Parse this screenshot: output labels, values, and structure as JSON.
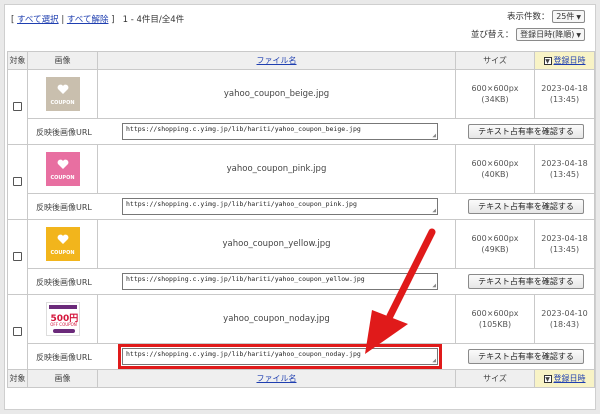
{
  "header": {
    "select_all": "すべて選択",
    "separator": "|",
    "deselect_all": "すべて解除",
    "bracket_open": "[",
    "bracket_close": "]",
    "range_text": "1 - 4件目/全4件",
    "per_page_label": "表示件数：",
    "per_page_value": "25件",
    "sort_label": "並び替え：",
    "sort_value": "登録日時(降順)"
  },
  "columns": {
    "target": "対象",
    "image": "画像",
    "filename": "ファイル名",
    "size": "サイズ",
    "date": "登録日時"
  },
  "url_label": "反映後画像URL",
  "check_button": "テキスト占有率を確認する",
  "rows": [
    {
      "filename": "yahoo_coupon_beige.jpg",
      "dimensions": "600×600px",
      "filesize": "(34KB)",
      "date": "2023-04-18",
      "time": "(13:45)",
      "url": "https://shopping.c.yimg.jp/lib/hariti/yahoo_coupon_beige.jpg",
      "thumb_color": "#c9bfae",
      "thumb_text": "COUPON"
    },
    {
      "filename": "yahoo_coupon_pink.jpg",
      "dimensions": "600×600px",
      "filesize": "(40KB)",
      "date": "2023-04-18",
      "time": "(13:45)",
      "url": "https://shopping.c.yimg.jp/lib/hariti/yahoo_coupon_pink.jpg",
      "thumb_color": "#e86fa1",
      "thumb_text": "COUPON"
    },
    {
      "filename": "yahoo_coupon_yellow.jpg",
      "dimensions": "600×600px",
      "filesize": "(49KB)",
      "date": "2023-04-18",
      "time": "(13:45)",
      "url": "https://shopping.c.yimg.jp/lib/hariti/yahoo_coupon_yellow.jpg",
      "thumb_color": "#f2b51c",
      "thumb_text": "COUPON"
    },
    {
      "filename": "yahoo_coupon_noday.jpg",
      "dimensions": "600×600px",
      "filesize": "(105KB)",
      "date": "2023-04-10",
      "time": "(18:43)",
      "url": "https://shopping.c.yimg.jp/lib/hariti/yahoo_coupon_noday.jpg",
      "thumb_amount": "500円",
      "thumb_off": "OFF COUPON"
    }
  ],
  "colors": {
    "link": "#1f3fb0",
    "highlight": "#e01a1a",
    "sort_header_bg": "#f8f3c6"
  }
}
